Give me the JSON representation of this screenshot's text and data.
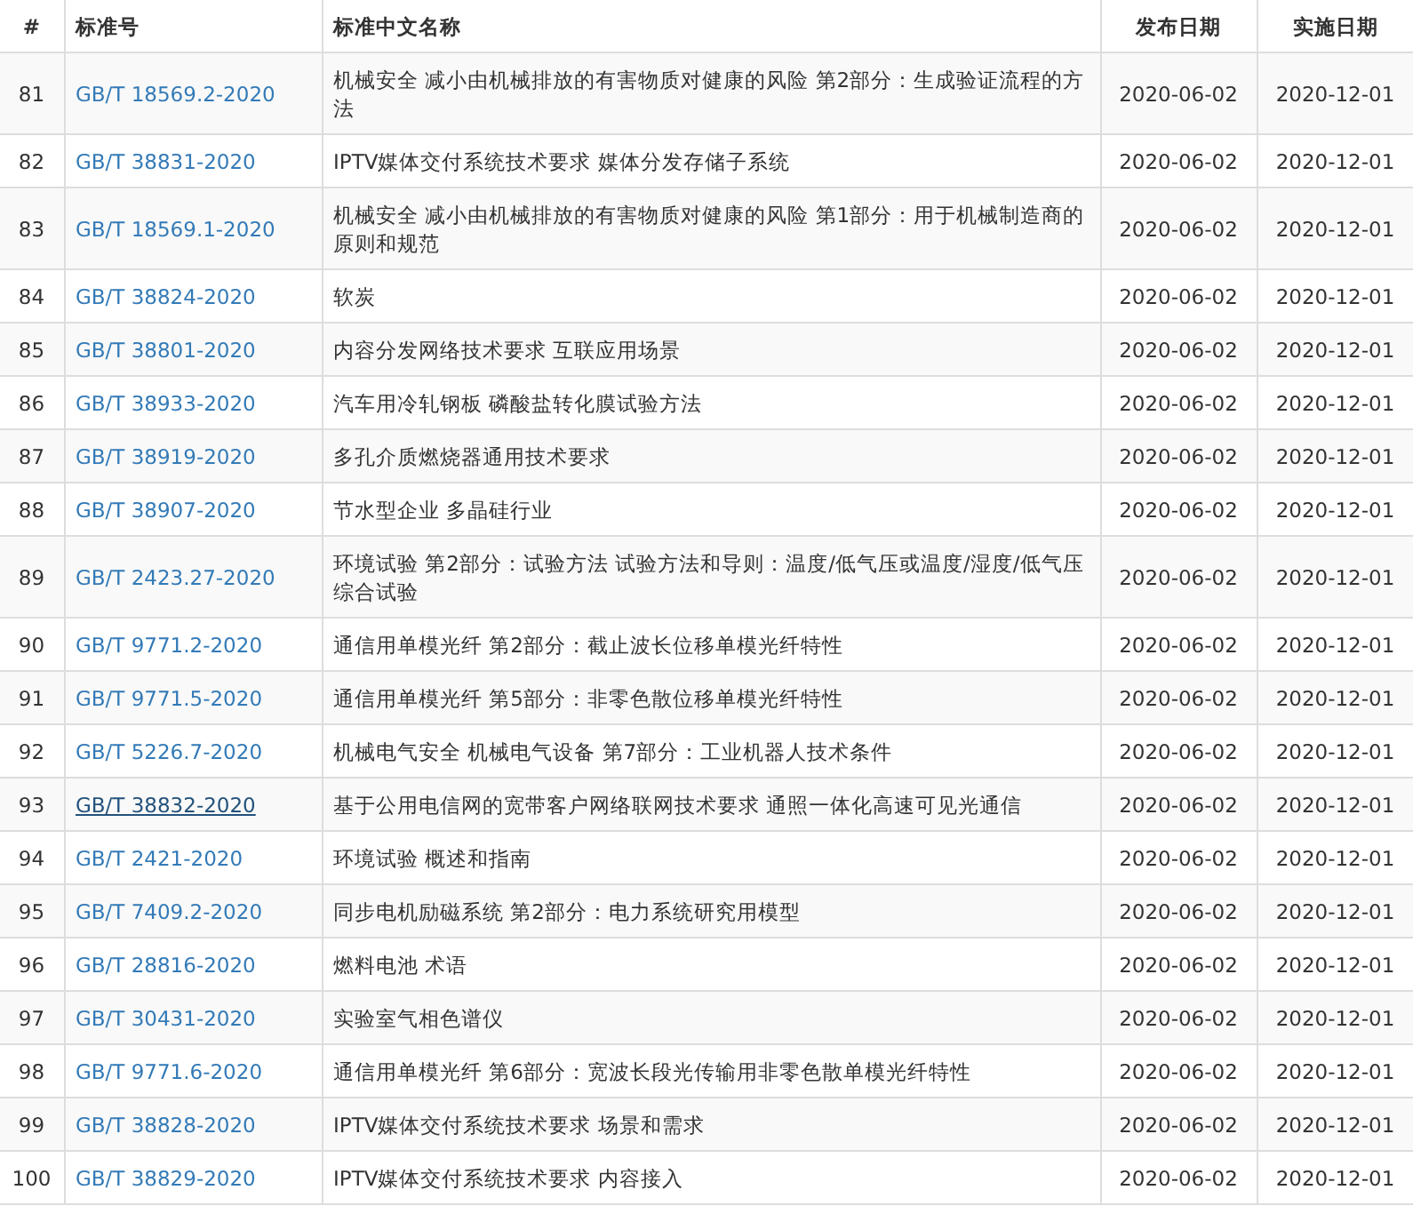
{
  "table": {
    "columns": [
      "#",
      "标准号",
      "标准中文名称",
      "发布日期",
      "实施日期"
    ],
    "rows": [
      {
        "index": "81",
        "code": "GB/T 18569.2-2020",
        "hovered": false,
        "name": "机械安全 减小由机械排放的有害物质对健康的风险 第2部分：生成验证流程的方法",
        "published": "2020-06-02",
        "effective": "2020-12-01"
      },
      {
        "index": "82",
        "code": "GB/T 38831-2020",
        "hovered": false,
        "name": "IPTV媒体交付系统技术要求 媒体分发存储子系统",
        "published": "2020-06-02",
        "effective": "2020-12-01"
      },
      {
        "index": "83",
        "code": "GB/T 18569.1-2020",
        "hovered": false,
        "name": "机械安全 减小由机械排放的有害物质对健康的风险 第1部分：用于机械制造商的原则和规范",
        "published": "2020-06-02",
        "effective": "2020-12-01"
      },
      {
        "index": "84",
        "code": "GB/T 38824-2020",
        "hovered": false,
        "name": "软炭",
        "published": "2020-06-02",
        "effective": "2020-12-01"
      },
      {
        "index": "85",
        "code": "GB/T 38801-2020",
        "hovered": false,
        "name": "内容分发网络技术要求 互联应用场景",
        "published": "2020-06-02",
        "effective": "2020-12-01"
      },
      {
        "index": "86",
        "code": "GB/T 38933-2020",
        "hovered": false,
        "name": "汽车用冷轧钢板 磷酸盐转化膜试验方法",
        "published": "2020-06-02",
        "effective": "2020-12-01"
      },
      {
        "index": "87",
        "code": "GB/T 38919-2020",
        "hovered": false,
        "name": "多孔介质燃烧器通用技术要求",
        "published": "2020-06-02",
        "effective": "2020-12-01"
      },
      {
        "index": "88",
        "code": "GB/T 38907-2020",
        "hovered": false,
        "name": "节水型企业 多晶硅行业",
        "published": "2020-06-02",
        "effective": "2020-12-01"
      },
      {
        "index": "89",
        "code": "GB/T 2423.27-2020",
        "hovered": false,
        "name": "环境试验 第2部分：试验方法 试验方法和导则：温度/低气压或温度/湿度/低气压综合试验",
        "published": "2020-06-02",
        "effective": "2020-12-01"
      },
      {
        "index": "90",
        "code": "GB/T 9771.2-2020",
        "hovered": false,
        "name": "通信用单模光纤 第2部分：截止波长位移单模光纤特性",
        "published": "2020-06-02",
        "effective": "2020-12-01"
      },
      {
        "index": "91",
        "code": "GB/T 9771.5-2020",
        "hovered": false,
        "name": "通信用单模光纤 第5部分：非零色散位移单模光纤特性",
        "published": "2020-06-02",
        "effective": "2020-12-01"
      },
      {
        "index": "92",
        "code": "GB/T 5226.7-2020",
        "hovered": false,
        "name": "机械电气安全 机械电气设备 第7部分：工业机器人技术条件",
        "published": "2020-06-02",
        "effective": "2020-12-01"
      },
      {
        "index": "93",
        "code": "GB/T 38832-2020",
        "hovered": true,
        "name": "基于公用电信网的宽带客户网络联网技术要求 通照一体化高速可见光通信",
        "published": "2020-06-02",
        "effective": "2020-12-01"
      },
      {
        "index": "94",
        "code": "GB/T 2421-2020",
        "hovered": false,
        "name": "环境试验 概述和指南",
        "published": "2020-06-02",
        "effective": "2020-12-01"
      },
      {
        "index": "95",
        "code": "GB/T 7409.2-2020",
        "hovered": false,
        "name": "同步电机励磁系统 第2部分：电力系统研究用模型",
        "published": "2020-06-02",
        "effective": "2020-12-01"
      },
      {
        "index": "96",
        "code": "GB/T 28816-2020",
        "hovered": false,
        "name": "燃料电池 术语",
        "published": "2020-06-02",
        "effective": "2020-12-01"
      },
      {
        "index": "97",
        "code": "GB/T 30431-2020",
        "hovered": false,
        "name": "实验室气相色谱仪",
        "published": "2020-06-02",
        "effective": "2020-12-01"
      },
      {
        "index": "98",
        "code": "GB/T 9771.6-2020",
        "hovered": false,
        "name": "通信用单模光纤 第6部分：宽波长段光传输用非零色散单模光纤特性",
        "published": "2020-06-02",
        "effective": "2020-12-01"
      },
      {
        "index": "99",
        "code": "GB/T 38828-2020",
        "hovered": false,
        "name": "IPTV媒体交付系统技术要求 场景和需求",
        "published": "2020-06-02",
        "effective": "2020-12-01"
      },
      {
        "index": "100",
        "code": "GB/T 38829-2020",
        "hovered": false,
        "name": "IPTV媒体交付系统技术要求 内容接入",
        "published": "2020-06-02",
        "effective": "2020-12-01"
      }
    ]
  }
}
